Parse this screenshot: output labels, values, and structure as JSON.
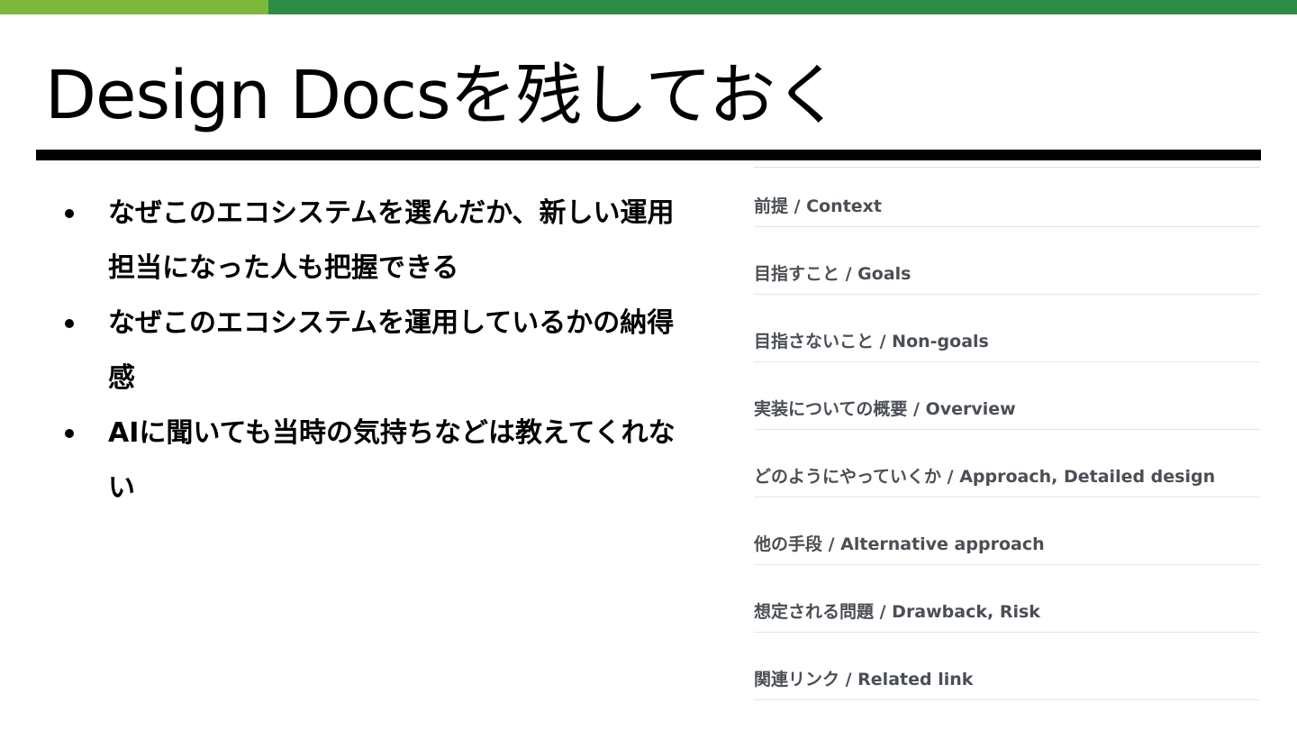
{
  "colors": {
    "accent_left": "#7cb83a",
    "accent_right": "#2e8b45"
  },
  "slide": {
    "title": "Design Docsを残しておく"
  },
  "bullets": [
    "なぜこのエコシステムを選んだか、新しい運用担当になった人も把握できる",
    "なぜこのエコシステムを運用しているかの納得感",
    "AIに聞いても当時の気持ちなどは教えてくれない"
  ],
  "toc": [
    "前提 / Context",
    "目指すこと / Goals",
    "目指さないこと / Non-goals",
    "実装についての概要 / Overview",
    "どのようにやっていくか / Approach, Detailed design",
    "他の手段 / Alternative approach",
    "想定される問題 / Drawback, Risk",
    "関連リンク / Related link"
  ]
}
